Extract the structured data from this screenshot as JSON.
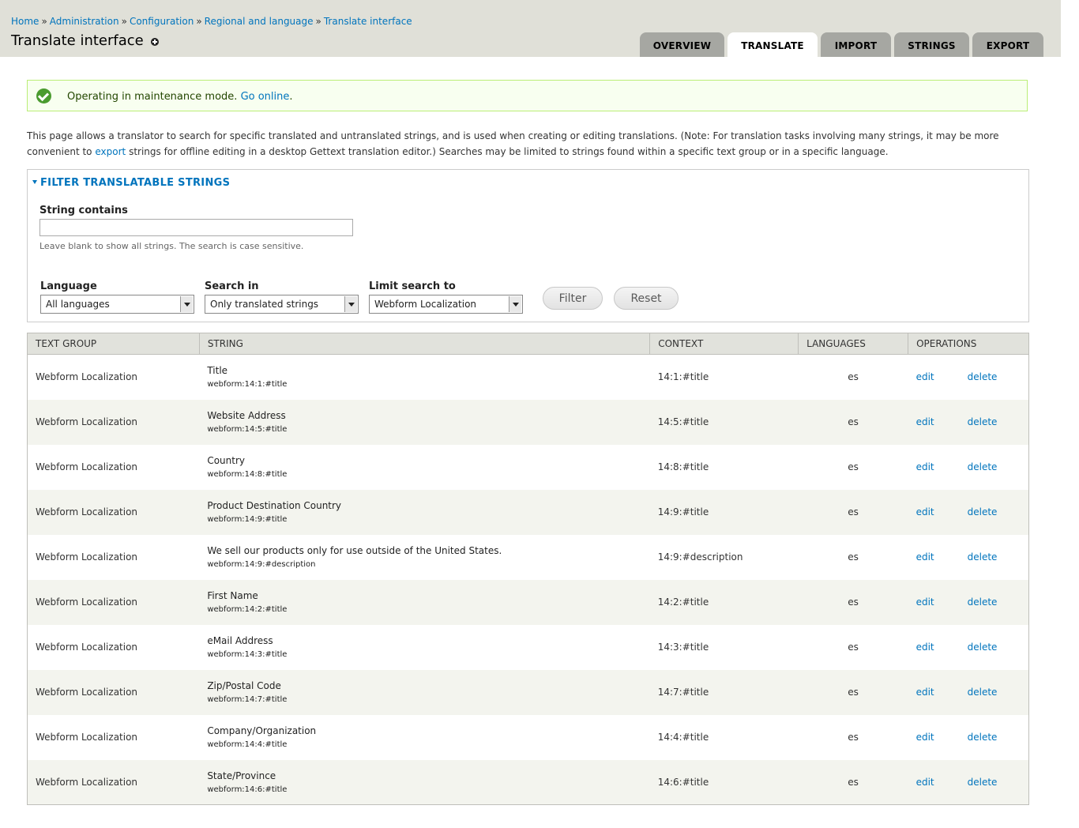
{
  "breadcrumb": [
    {
      "label": "Home"
    },
    {
      "label": "Administration"
    },
    {
      "label": "Configuration"
    },
    {
      "label": "Regional and language"
    },
    {
      "label": "Translate interface"
    }
  ],
  "breadcrumb_separator": "»",
  "page_title": "Translate interface",
  "tabs": [
    {
      "label": "OVERVIEW",
      "active": false
    },
    {
      "label": "TRANSLATE",
      "active": true
    },
    {
      "label": "IMPORT",
      "active": false
    },
    {
      "label": "STRINGS",
      "active": false
    },
    {
      "label": "EXPORT",
      "active": false
    }
  ],
  "message": {
    "text": "Operating in maintenance mode.",
    "link": "Go online",
    "tail": "."
  },
  "description": {
    "part1": "This page allows a translator to search for specific translated and untranslated strings, and is used when creating or editing translations. (Note: For translation tasks involving many strings, it may be more convenient to",
    "link": "export",
    "part2": "strings for offline editing in a desktop Gettext translation editor.) Searches may be limited to strings found within a specific text group or in a specific language."
  },
  "filter": {
    "legend": "FILTER TRANSLATABLE STRINGS",
    "string_contains_label": "String contains",
    "string_contains_value": "",
    "help": "Leave blank to show all strings. The search is case sensitive.",
    "language_label": "Language",
    "language_value": "All languages",
    "search_in_label": "Search in",
    "search_in_value": "Only translated strings",
    "limit_label": "Limit search to",
    "limit_value": "Webform Localization",
    "filter_button": "Filter",
    "reset_button": "Reset"
  },
  "table": {
    "headers": [
      "TEXT GROUP",
      "STRING",
      "CONTEXT",
      "LANGUAGES",
      "OPERATIONS"
    ],
    "edit_label": "edit",
    "delete_label": "delete",
    "rows": [
      {
        "group": "Webform Localization",
        "string": "Title",
        "location": "webform:14:1:#title",
        "context": "14:1:#title",
        "languages": "es"
      },
      {
        "group": "Webform Localization",
        "string": "Website Address",
        "location": "webform:14:5:#title",
        "context": "14:5:#title",
        "languages": "es"
      },
      {
        "group": "Webform Localization",
        "string": "Country",
        "location": "webform:14:8:#title",
        "context": "14:8:#title",
        "languages": "es"
      },
      {
        "group": "Webform Localization",
        "string": "Product Destination Country",
        "location": "webform:14:9:#title",
        "context": "14:9:#title",
        "languages": "es"
      },
      {
        "group": "Webform Localization",
        "string": "We sell our products only for use outside of the United States.",
        "location": "webform:14:9:#description",
        "context": "14:9:#description",
        "languages": "es"
      },
      {
        "group": "Webform Localization",
        "string": "First Name",
        "location": "webform:14:2:#title",
        "context": "14:2:#title",
        "languages": "es"
      },
      {
        "group": "Webform Localization",
        "string": "eMail Address",
        "location": "webform:14:3:#title",
        "context": "14:3:#title",
        "languages": "es"
      },
      {
        "group": "Webform Localization",
        "string": "Zip/Postal Code",
        "location": "webform:14:7:#title",
        "context": "14:7:#title",
        "languages": "es"
      },
      {
        "group": "Webform Localization",
        "string": "Company/Organization",
        "location": "webform:14:4:#title",
        "context": "14:4:#title",
        "languages": "es"
      },
      {
        "group": "Webform Localization",
        "string": "State/Province",
        "location": "webform:14:6:#title",
        "context": "14:6:#title",
        "languages": "es"
      }
    ]
  }
}
